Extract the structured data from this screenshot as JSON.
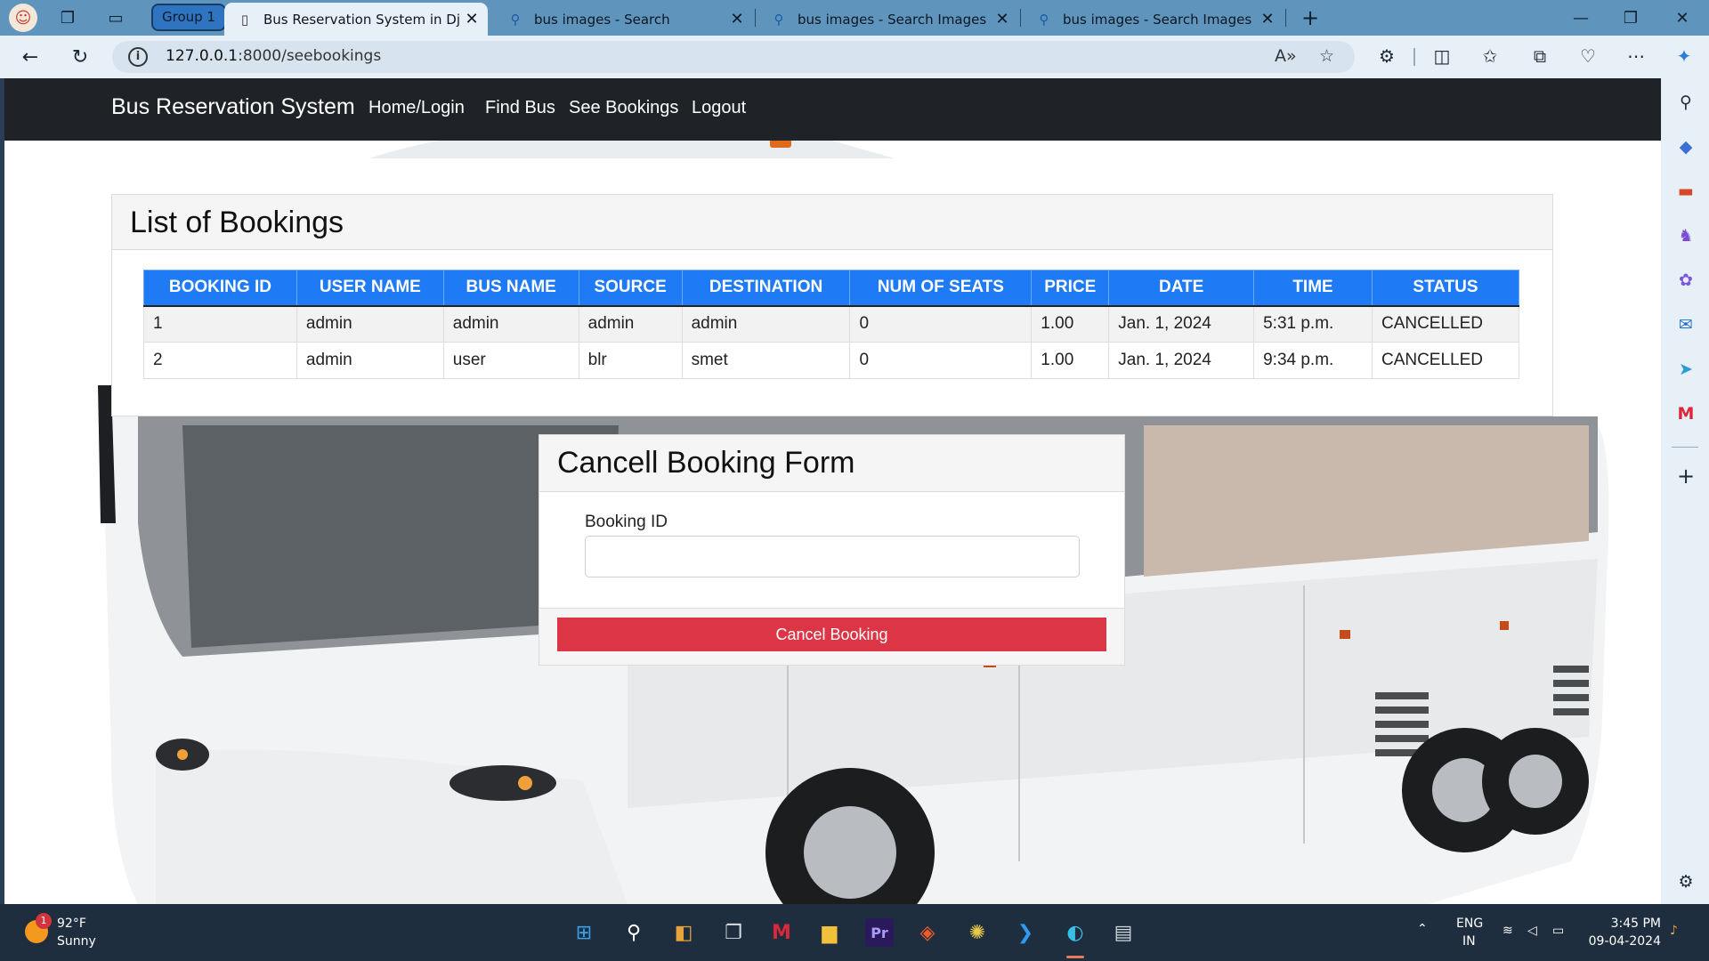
{
  "browser": {
    "group_label": "Group 1",
    "tabs": [
      {
        "label": "Bus Reservation System in Djang",
        "icon": "page-icon",
        "active": true
      },
      {
        "label": "bus images - Search",
        "icon": "search-icon",
        "active": false
      },
      {
        "label": "bus images - Search Images",
        "icon": "search-icon",
        "active": false
      },
      {
        "label": "bus images - Search Images",
        "icon": "search-icon",
        "active": false
      }
    ],
    "url_host": "127.0.0.1",
    "url_rest": ":8000/seebookings"
  },
  "navbar": {
    "brand": "Bus Reservation System",
    "links": [
      "Home/Login",
      "Find Bus",
      "See Bookings",
      "Logout"
    ]
  },
  "bookings": {
    "title": "List of Bookings",
    "columns": [
      "BOOKING ID",
      "USER NAME",
      "BUS NAME",
      "SOURCE",
      "DESTINATION",
      "NUM OF SEATS",
      "PRICE",
      "DATE",
      "TIME",
      "STATUS"
    ],
    "rows": [
      [
        "1",
        "admin",
        "admin",
        "admin",
        "admin",
        "0",
        "1.00",
        "Jan. 1, 2024",
        "5:31 p.m.",
        "CANCELLED"
      ],
      [
        "2",
        "admin",
        "user",
        "blr",
        "smet",
        "0",
        "1.00",
        "Jan. 1, 2024",
        "9:34 p.m.",
        "CANCELLED"
      ]
    ]
  },
  "cancel_form": {
    "title": "Cancell Booking Form",
    "field_label": "Booking ID",
    "field_value": "",
    "button_label": "Cancel Booking"
  },
  "taskbar": {
    "weather_temp": "92°F",
    "weather_cond": "Sunny",
    "weather_badge": "1",
    "lang_top": "ENG",
    "lang_bottom": "IN",
    "time": "3:45 PM",
    "date": "09-04-2024"
  },
  "colors": {
    "navbar_bg": "#1f2327",
    "table_header": "#1f7bf5",
    "cancel_button": "#dc3545",
    "tabbar_bg": "#5f94bd"
  }
}
